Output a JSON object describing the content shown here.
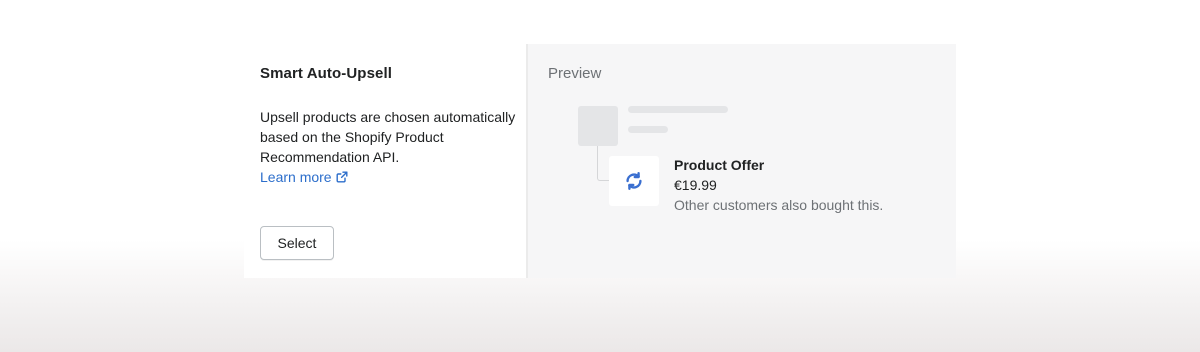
{
  "smart_upsell": {
    "title": "Smart Auto-Upsell",
    "description": "Upsell products are chosen automatically based on the Shopify Product Recommendation API.",
    "learn_more_label": "Learn more",
    "learn_more_icon": "external-link-icon",
    "select_label": "Select"
  },
  "preview": {
    "title": "Preview",
    "offer": {
      "image_icon": "refresh-icon",
      "name": "Product Offer",
      "price": "€19.99",
      "description": "Other customers also bought this."
    }
  },
  "colors": {
    "link": "#2c6ecb",
    "icon_blue": "#3a6fd0",
    "preview_bg": "#f6f6f7",
    "placeholder": "#e4e5e7"
  }
}
